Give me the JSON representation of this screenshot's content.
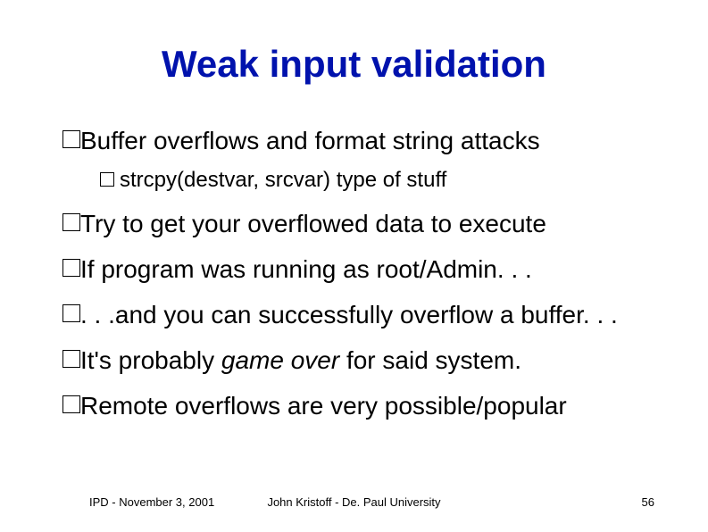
{
  "title": "Weak input validation",
  "bullets": {
    "b1": "Buffer overflows and format string attacks",
    "b1a": "strcpy(destvar, srcvar) type of stuff",
    "b2": "Try to get your overflowed data to execute",
    "b3": "If program was running as root/Admin. . .",
    "b4": ". . .and you can successfully overflow a buffer. . .",
    "b5_pre": "It's probably ",
    "b5_em": "game over",
    "b5_post": " for said system.",
    "b6": "Remote overflows are very possible/popular"
  },
  "footer": {
    "left": "IPD - November 3, 2001",
    "center": "John Kristoff - De. Paul University",
    "right": "56"
  }
}
